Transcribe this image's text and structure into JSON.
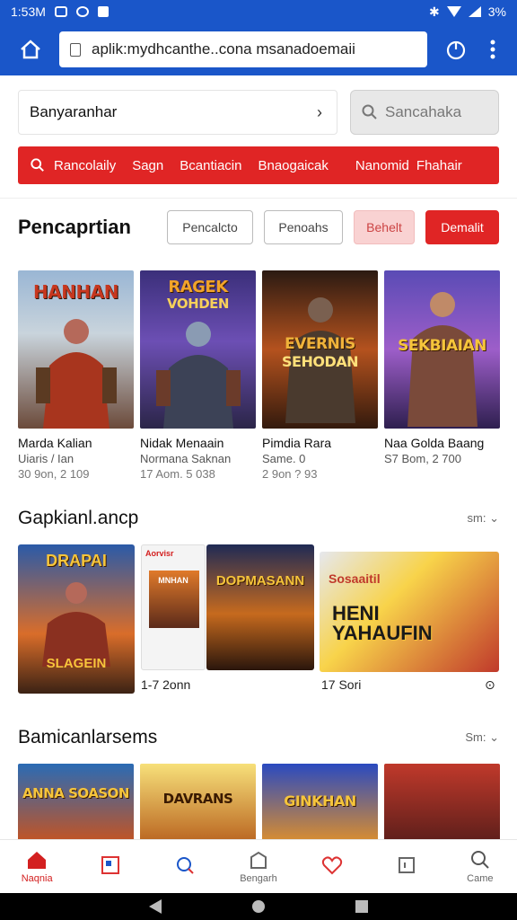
{
  "status_bar": {
    "time": "1:53M",
    "battery": "3%"
  },
  "browser": {
    "url": "aplik:mydhcanthe..cona msanadoemaii"
  },
  "search": {
    "dropdown_label": "Banyaranhar",
    "placeholder": "Sancahaka"
  },
  "filter_bar": {
    "items": [
      "Rancolaily",
      "Sagn",
      "Bcantiacin",
      "Bnaogaicak",
      "Nanomid",
      "Fhahair"
    ]
  },
  "section_featured": {
    "title": "Pencaprtian",
    "chips": [
      "Pencalcto",
      "Penoahs",
      "Behelt",
      "Demalit"
    ],
    "cards": [
      {
        "cover_title": "HANHAN",
        "cover_sub": "",
        "name": "Marda Kalian",
        "sub": "Uiaris / Ian",
        "meta": "30 9on, 2 109"
      },
      {
        "cover_title": "RAGEK",
        "cover_sub": "VOHDEN",
        "name": "Nidak Menaain",
        "sub": "Normana Saknan",
        "meta": "17 Aom. 5 038"
      },
      {
        "cover_title": "EVERNIS",
        "cover_sub": "SEHODAN",
        "name": "Pimdia Rara",
        "sub": "Same. 0",
        "meta": "2 9on ? 93"
      },
      {
        "cover_title": "SEKBIAIAN",
        "cover_sub": "",
        "name": "Naa Golda Baang",
        "sub": "S7 Bom, 2 700",
        "meta": ""
      }
    ]
  },
  "section_second": {
    "title": "Gapkianl.ancp",
    "more": "sm:",
    "tiles": [
      {
        "title": "DRAPAI",
        "sub": "SLAGEIN"
      },
      {
        "title": "MNHAN",
        "tag": "Aorvisr"
      },
      {
        "title": "DOPMASANN"
      },
      {
        "title": "HENI YAHAUFIN",
        "tag": "Sosaaitil"
      }
    ],
    "captions": [
      "1-7 2onn",
      "17 Sori"
    ]
  },
  "section_third": {
    "title": "Bamicanlarsems",
    "more": "Sm:",
    "tiles": [
      {
        "title": "ANNA SOASON"
      },
      {
        "title": "DAVRANS"
      },
      {
        "title": "GINKHAN"
      },
      {
        "title": ""
      }
    ]
  },
  "bottom_nav": {
    "items": [
      {
        "label": "Naqnia",
        "icon": "home-icon"
      },
      {
        "label": "",
        "icon": "window-icon"
      },
      {
        "label": "",
        "icon": "search-chat-icon"
      },
      {
        "label": "Bengarh",
        "icon": "building-icon"
      },
      {
        "label": "",
        "icon": "heart-icon"
      },
      {
        "label": "",
        "icon": "frame-icon"
      },
      {
        "label": "Came",
        "icon": "search-icon"
      }
    ]
  },
  "colors": {
    "header": "#1a56c9",
    "accent": "#e02525"
  }
}
